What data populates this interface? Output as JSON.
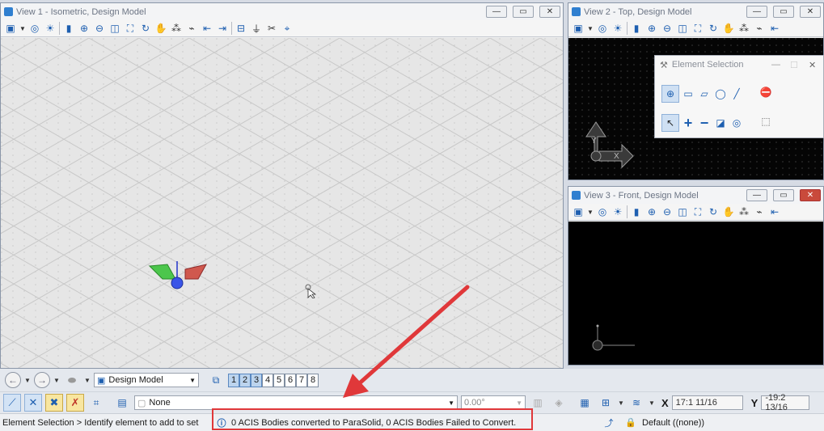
{
  "view1": {
    "title": "View 1 - Isometric, Design Model"
  },
  "view2": {
    "title": "View 2 - Top, Design Model",
    "axis_y": "Y",
    "axis_x": "X"
  },
  "view3": {
    "title": "View 3 - Front, Design Model"
  },
  "window_controls": {
    "minimize": "—",
    "restore": "▭",
    "close": "✕"
  },
  "element_selection": {
    "title": "Element Selection",
    "minimize": "—",
    "maximize": "☐",
    "close": "✕"
  },
  "nav": {
    "model": "Design Model",
    "view_numbers": [
      "1",
      "2",
      "3",
      "4",
      "5",
      "6",
      "7",
      "8"
    ],
    "active_views": [
      "1",
      "2",
      "3"
    ]
  },
  "attributes": {
    "level": "None",
    "angle": "0.00°",
    "x_label": "X",
    "x_value": "17:1 11/16",
    "y_label": "Y",
    "y_value": "-19:2 13/16"
  },
  "status": {
    "prompt": "Element Selection > Identify element to add to set",
    "message": "0 ACIS Bodies converted to ParaSolid, 0 ACIS Bodies Failed to Convert.",
    "level_display": "Default ((none))"
  },
  "colors": {
    "annotation_red": "#e0383a",
    "accent_blue": "#1e5fb0",
    "view_background_dark": "#000000",
    "view_background_light": "#e6e6e6"
  }
}
